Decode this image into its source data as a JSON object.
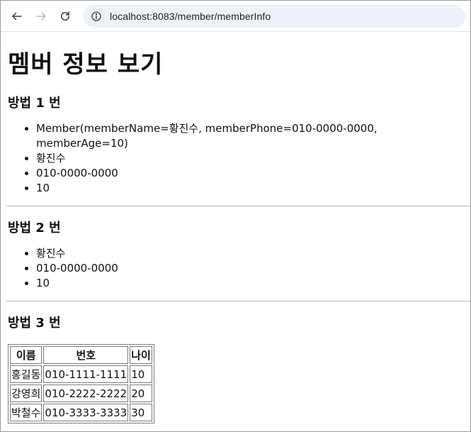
{
  "browser": {
    "url": "localhost:8083/member/memberInfo",
    "icons": {
      "back": "arrow-left-icon",
      "forward": "arrow-right-icon",
      "reload": "reload-icon",
      "site_info": "info-circle-icon"
    }
  },
  "page": {
    "title": "멤버 정보 보기",
    "section1": {
      "heading": "방법 1 번",
      "items": [
        "Member(memberName=황진수, memberPhone=010-0000-0000, memberAge=10)",
        "황진수",
        "010-0000-0000",
        "10"
      ]
    },
    "section2": {
      "heading": "방법 2 번",
      "items": [
        "황진수",
        "010-0000-0000",
        "10"
      ]
    },
    "section3": {
      "heading": "방법 3 번",
      "table": {
        "headers": [
          "이름",
          "번호",
          "나이"
        ],
        "rows": [
          [
            "홍길동",
            "010-1111-1111",
            "10"
          ],
          [
            "강영희",
            "010-2222-2222",
            "20"
          ],
          [
            "박철수",
            "010-3333-3333",
            "30"
          ]
        ]
      }
    }
  }
}
